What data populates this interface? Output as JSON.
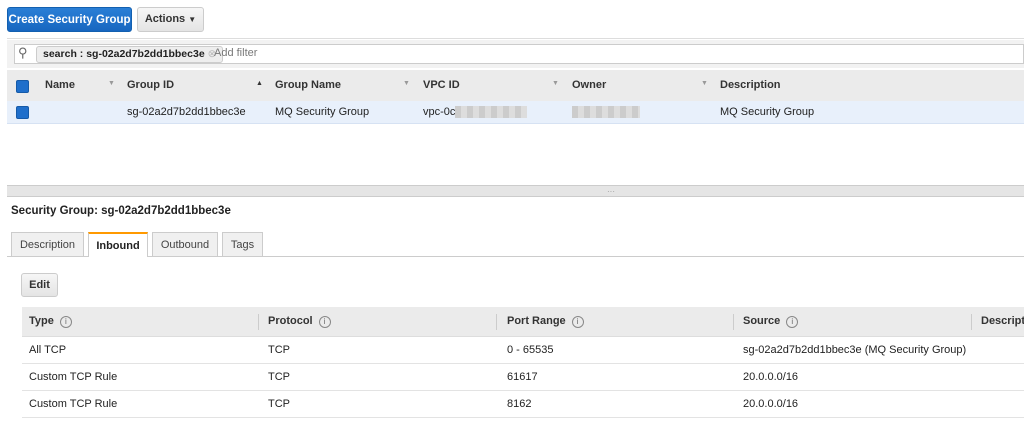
{
  "toolbar": {
    "create_label": "Create Security Group",
    "actions_label": "Actions"
  },
  "filter": {
    "token": "search : sg-02a2d7b2dd1bbec3e",
    "placeholder": "Add filter"
  },
  "table": {
    "headers": [
      "Name",
      "Group ID",
      "Group Name",
      "VPC ID",
      "Owner",
      "Description"
    ],
    "row": {
      "name": "",
      "group_id": "sg-02a2d7b2dd1bbec3e",
      "group_name": "MQ Security Group",
      "vpc_id": "vpc-0c3",
      "description": "MQ Security Group"
    }
  },
  "details": {
    "title": "Security Group: sg-02a2d7b2dd1bbec3e",
    "tabs": [
      "Description",
      "Inbound",
      "Outbound",
      "Tags"
    ],
    "edit_label": "Edit",
    "rules_headers": [
      "Type",
      "Protocol",
      "Port Range",
      "Source",
      "Descripti"
    ],
    "rules": [
      {
        "type": "All TCP",
        "protocol": "TCP",
        "port": "0 - 65535",
        "source": "sg-02a2d7b2dd1bbec3e (MQ Security Group)"
      },
      {
        "type": "Custom TCP Rule",
        "protocol": "TCP",
        "port": "61617",
        "source": "20.0.0.0/16"
      },
      {
        "type": "Custom TCP Rule",
        "protocol": "TCP",
        "port": "8162",
        "source": "20.0.0.0/16"
      }
    ]
  }
}
